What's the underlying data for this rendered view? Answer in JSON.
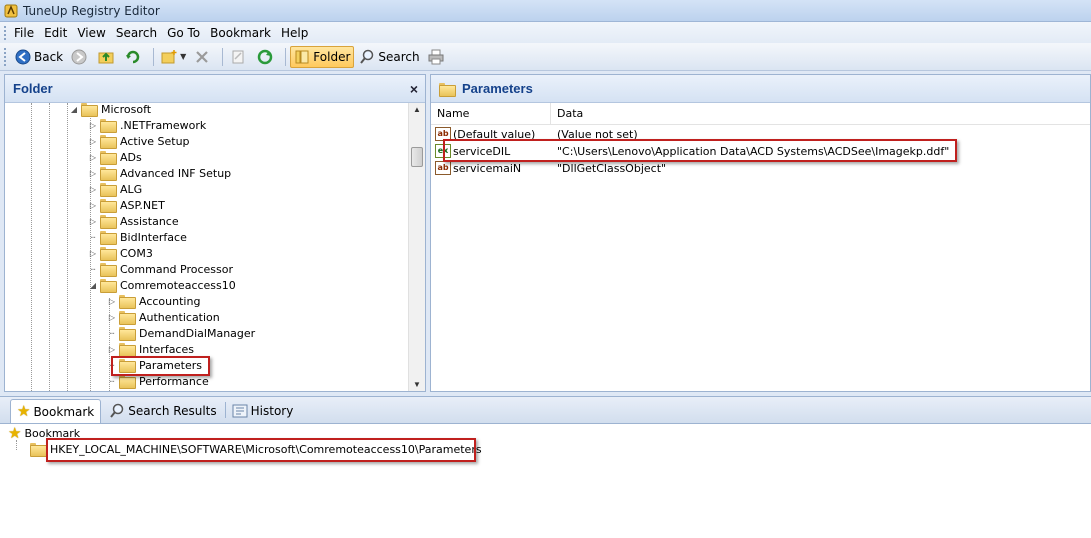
{
  "window": {
    "title": "TuneUp Registry Editor"
  },
  "menu": [
    "File",
    "Edit",
    "View",
    "Search",
    "Go To",
    "Bookmark",
    "Help"
  ],
  "toolbar": {
    "back_label": "Back",
    "folder_label": "Folder",
    "search_label": "Search"
  },
  "folder_pane": {
    "title": "Folder",
    "close": "×",
    "tree": [
      {
        "label": "Microsoft",
        "level": 0,
        "expander": "expanded"
      },
      {
        "label": ".NETFramework",
        "level": 1,
        "expander": "collapsed"
      },
      {
        "label": "Active Setup",
        "level": 1,
        "expander": "collapsed"
      },
      {
        "label": "ADs",
        "level": 1,
        "expander": "collapsed"
      },
      {
        "label": "Advanced INF Setup",
        "level": 1,
        "expander": "collapsed"
      },
      {
        "label": "ALG",
        "level": 1,
        "expander": "collapsed"
      },
      {
        "label": "ASP.NET",
        "level": 1,
        "expander": "collapsed"
      },
      {
        "label": "Assistance",
        "level": 1,
        "expander": "collapsed"
      },
      {
        "label": "BidInterface",
        "level": 1,
        "expander": "none"
      },
      {
        "label": "COM3",
        "level": 1,
        "expander": "collapsed"
      },
      {
        "label": "Command Processor",
        "level": 1,
        "expander": "none"
      },
      {
        "label": "Comremoteaccess10",
        "level": 1,
        "expander": "expanded"
      },
      {
        "label": "Accounting",
        "level": 2,
        "expander": "collapsed"
      },
      {
        "label": "Authentication",
        "level": 2,
        "expander": "collapsed"
      },
      {
        "label": "DemandDialManager",
        "level": 2,
        "expander": "none"
      },
      {
        "label": "Interfaces",
        "level": 2,
        "expander": "collapsed"
      },
      {
        "label": "Parameters",
        "level": 2,
        "expander": "none",
        "selected": true
      },
      {
        "label": "Performance",
        "level": 2,
        "expander": "none"
      }
    ]
  },
  "data_pane": {
    "title": "Parameters",
    "columns": {
      "name": "Name",
      "data": "Data"
    },
    "rows": [
      {
        "icon": "ab",
        "name": "(Default value)",
        "data": "(Value not set)"
      },
      {
        "icon": "ex",
        "name": "serviceDIL",
        "data": "\"C:\\Users\\Lenovo\\Application Data\\ACD Systems\\ACDSee\\Imagekp.ddf\""
      },
      {
        "icon": "ab",
        "name": "servicemaiN",
        "data": "\"DllGetClassObject\""
      }
    ]
  },
  "bottom_tabs": [
    "Bookmark",
    "Search Results",
    "History"
  ],
  "bookmarks": {
    "root": "Bookmark",
    "items": [
      "HKEY_LOCAL_MACHINE\\SOFTWARE\\Microsoft\\Comremoteaccess10\\Parameters"
    ]
  },
  "colors": {
    "highlight": "#c0201e",
    "header_text": "#15428b"
  }
}
